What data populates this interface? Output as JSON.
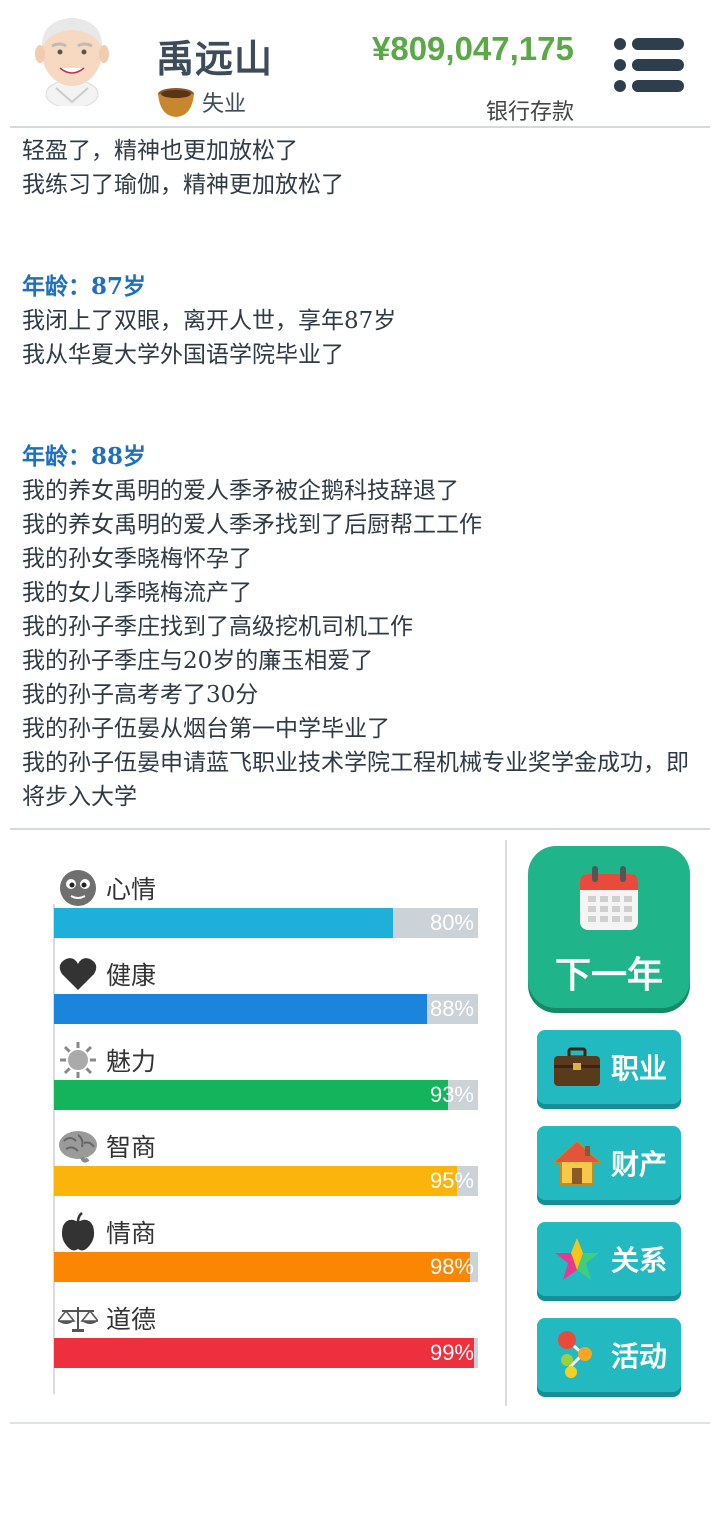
{
  "player": {
    "name": "禹远山",
    "job": "失业",
    "money": "¥809,047,175",
    "money_label": "银行存款"
  },
  "log": {
    "intro_lines": [
      "轻盈了，精神也更加放松了",
      "我练习了瑜伽，精神更加放松了"
    ],
    "age87": {
      "age": "年龄：87岁",
      "lines": [
        "我闭上了双眼，离开人世，享年87岁",
        "我从华夏大学外国语学院毕业了"
      ]
    },
    "age88": {
      "age": "年龄：88岁",
      "lines": [
        "我的养女禹明的爱人季矛被企鹅科技辞退了",
        "我的养女禹明的爱人季矛找到了后厨帮工工作",
        "我的孙女季晓梅怀孕了",
        "我的女儿季晓梅流产了",
        "我的孙子季庄找到了高级挖机司机工作",
        "我的孙子季庄与20岁的廉玉相爱了",
        "我的孙子高考考了30分",
        "我的孙子伍晏从烟台第一中学毕业了",
        "我的孙子伍晏申请蓝飞职业技术学院工程机械专业奖学金成功，即将步入大学"
      ]
    }
  },
  "stats": [
    {
      "label": "心情",
      "icon": "face-icon",
      "percent": 80,
      "text": "80%",
      "color": "#1eb0d8"
    },
    {
      "label": "健康",
      "icon": "heart-icon",
      "percent": 88,
      "text": "88%",
      "color": "#1b84dc"
    },
    {
      "label": "魅力",
      "icon": "sun-icon",
      "percent": 93,
      "text": "93%",
      "color": "#13b45b"
    },
    {
      "label": "智商",
      "icon": "brain-icon",
      "percent": 95,
      "text": "95%",
      "color": "#fbb40c"
    },
    {
      "label": "情商",
      "icon": "apple-icon",
      "percent": 98,
      "text": "98%",
      "color": "#fb8604"
    },
    {
      "label": "道德",
      "icon": "scales-icon",
      "percent": 99,
      "text": "99%",
      "color": "#ee2f3e"
    }
  ],
  "buttons": {
    "next_year": "下一年",
    "career": "职业",
    "property": "财产",
    "relations": "关系",
    "activities": "活动"
  }
}
